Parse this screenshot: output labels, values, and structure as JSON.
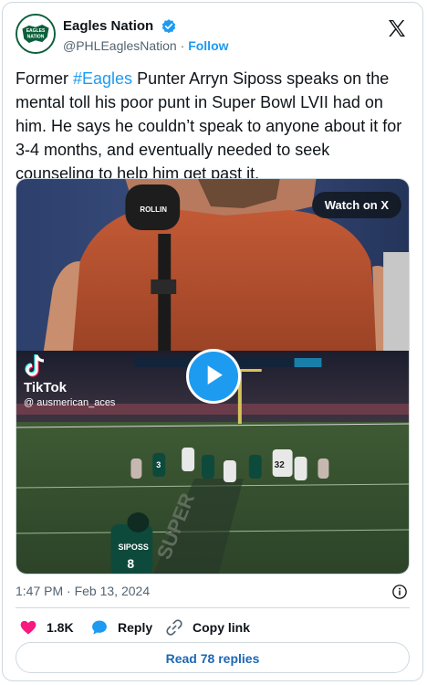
{
  "author": {
    "display_name": "Eagles Nation",
    "handle": "@PHLEaglesNation",
    "separator": "·",
    "follow_label": "Follow",
    "avatar_text_top": "EAGLES",
    "avatar_text_bottom": "NATION"
  },
  "tweet": {
    "text_before_hashtag": "Former ",
    "hashtag": "#Eagles",
    "text_after_hashtag": " Punter Arryn Siposs speaks on the mental toll his poor punt in Super Bowl LVII had on him. He says he couldn’t speak to anyone about it for 3-4 months, and eventually needed to seek counseling to help him get past it."
  },
  "media": {
    "watch_label": "Watch on X",
    "mic_brand": "ROLLIN",
    "tiktok_label": "TikTok",
    "tiktok_handle": "@ ausmerican_aces",
    "player_name": "SIPOSS",
    "player_number": "8",
    "jersey_numbers": [
      "3",
      "32"
    ],
    "field_text": "SUPER"
  },
  "meta": {
    "time": "1:47 PM",
    "separator": "·",
    "date": "Feb 13, 2024"
  },
  "actions": {
    "likes": "1.8K",
    "reply_label": "Reply",
    "copy_link_label": "Copy link",
    "read_replies_label": "Read 78 replies"
  },
  "icons": {
    "verified": "verified-badge-icon",
    "x_logo": "x-logo-icon",
    "info": "info-icon",
    "heart": "heart-icon",
    "reply": "reply-bubble-icon",
    "link": "link-icon",
    "play": "play-icon",
    "tiktok": "tiktok-icon"
  },
  "colors": {
    "accent": "#1d9bf0",
    "heart": "#f91880",
    "text": "#0f1419",
    "muted": "#536471",
    "border": "#cfd9de",
    "eagles_green": "#0b5f3a"
  }
}
